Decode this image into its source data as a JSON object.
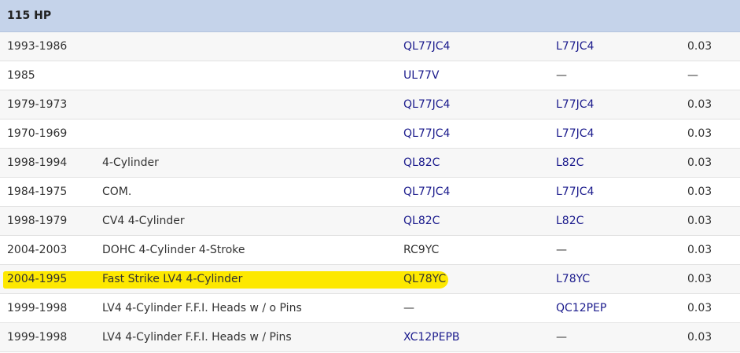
{
  "section": {
    "title": "115 HP"
  },
  "rows": [
    {
      "year": "1993-1986",
      "desc": "",
      "part1": "QL77JC4",
      "part2": "L77JC4",
      "gap": "0.03",
      "part1_link": true,
      "part2_link": true
    },
    {
      "year": "1985",
      "desc": "",
      "part1": "UL77V",
      "part2": "—",
      "gap": "—",
      "part1_link": true,
      "part2_link": false
    },
    {
      "year": "1979-1973",
      "desc": "",
      "part1": "QL77JC4",
      "part2": "L77JC4",
      "gap": "0.03",
      "part1_link": true,
      "part2_link": true
    },
    {
      "year": "1970-1969",
      "desc": "",
      "part1": "QL77JC4",
      "part2": "L77JC4",
      "gap": "0.03",
      "part1_link": true,
      "part2_link": true
    },
    {
      "year": "1998-1994",
      "desc": "4-Cylinder",
      "part1": "QL82C",
      "part2": "L82C",
      "gap": "0.03",
      "part1_link": true,
      "part2_link": true
    },
    {
      "year": "1984-1975",
      "desc": "COM.",
      "part1": "QL77JC4",
      "part2": "L77JC4",
      "gap": "0.03",
      "part1_link": true,
      "part2_link": true
    },
    {
      "year": "1998-1979",
      "desc": "CV4 4-Cylinder",
      "part1": "QL82C",
      "part2": "L82C",
      "gap": "0.03",
      "part1_link": true,
      "part2_link": true
    },
    {
      "year": "2004-2003",
      "desc": "DOHC 4-Cylinder 4-Stroke",
      "part1": "RC9YC",
      "part2": "—",
      "gap": "0.03",
      "part1_link": false,
      "part2_link": false
    },
    {
      "year": "2004-1995",
      "desc": "Fast Strike LV4 4-Cylinder",
      "part1": "QL78YC",
      "part2": "L78YC",
      "gap": "0.03",
      "part1_link": false,
      "part2_link": true,
      "highlighted": true
    },
    {
      "year": "1999-1998",
      "desc": "LV4 4-Cylinder F.F.I. Heads w / o Pins",
      "part1": "—",
      "part2": "QC12PEP",
      "gap": "0.03",
      "part1_link": false,
      "part2_link": true
    },
    {
      "year": "1999-1998",
      "desc": "LV4 4-Cylinder F.F.I. Heads w / Pins",
      "part1": "XC12PEPB",
      "part2": "—",
      "gap": "0.03",
      "part1_link": true,
      "part2_link": false
    }
  ],
  "colors": {
    "header_bg": "#c5d3ea",
    "link": "#1a1a8c",
    "text": "#333333",
    "highlight": "#fde800",
    "alt_row": "#f7f7f7"
  }
}
